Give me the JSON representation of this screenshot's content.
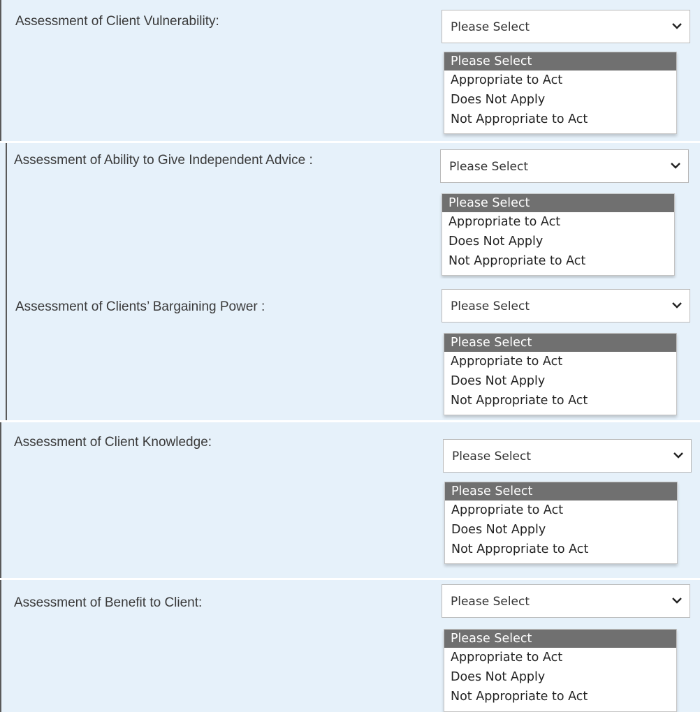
{
  "options": [
    "Please Select",
    "Appropriate to Act",
    "Does Not Apply",
    "Not Appropriate to Act"
  ],
  "sections": [
    {
      "label": "Assessment of Client Vulnerability:",
      "selected": "Please Select"
    },
    {
      "label": "Assessment of Ability to Give Independent Advice :",
      "selected": "Please Select"
    },
    {
      "label": "Assessment of Clients’ Bargaining Power :",
      "selected": "Please Select"
    },
    {
      "label": "Assessment of Client Knowledge:",
      "selected": "Please Select"
    },
    {
      "label": "Assessment of Benefit to Client:",
      "selected": "Please Select"
    }
  ],
  "icons": {
    "dropdown": "chevron-down-icon"
  },
  "colors": {
    "panel_bg": "#e6f1fa",
    "highlight": "#707070"
  }
}
